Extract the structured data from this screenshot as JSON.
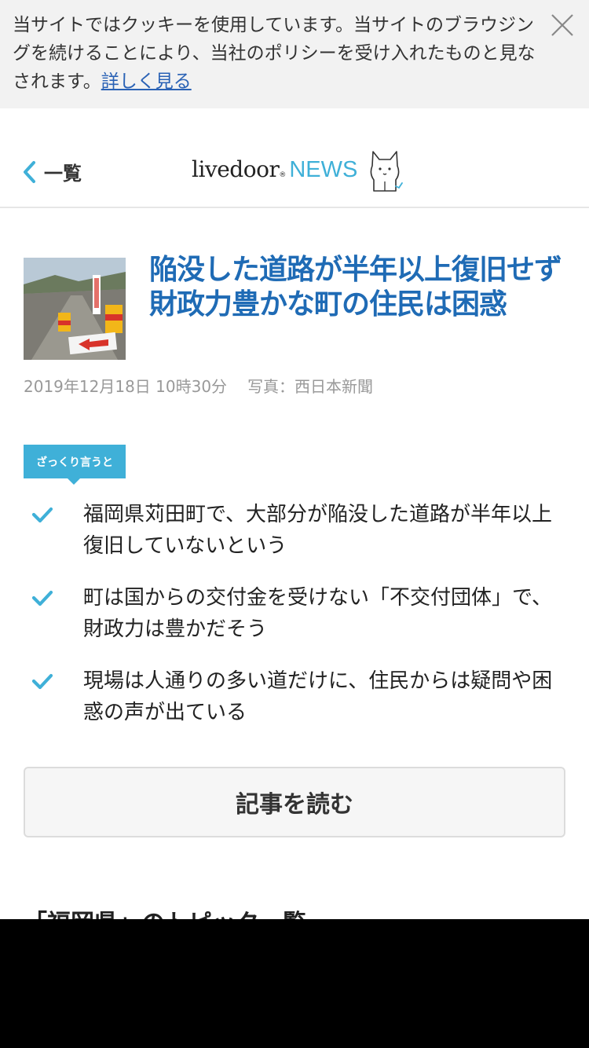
{
  "cookie": {
    "message": "当サイトではクッキーを使用しています。当サイトのブラウジングを続けることにより、当社のポリシーを受け入れたものと見なされます。",
    "link": "詳しく見る"
  },
  "header": {
    "back_label": "一覧",
    "logo_main": "livedoor",
    "logo_mark": "®",
    "logo_news": "NEWS"
  },
  "article": {
    "headline": "陥没した道路が半年以上復旧せず 財政力豊かな町の住民は困惑",
    "date": "2019年12月18日 10時30分",
    "photo_credit": "写真：西日本新聞",
    "tag": "ざっくり言うと",
    "points": [
      "福岡県苅田町で、大部分が陥没した道路が半年以上復旧していないという",
      "町は国からの交付金を受けない「不交付団体」で、財政力は豊かだそう",
      "現場は人通りの多い道だけに、住民からは疑問や困惑の声が出ている"
    ],
    "read_button": "記事を読む"
  },
  "next_section_peek": "「福岡県」のトピック一覧",
  "colors": {
    "accent": "#3fb0d8",
    "headline": "#1f6bb5",
    "link": "#2a62b5"
  },
  "icons": {
    "close": "close-icon",
    "back": "chevron-left-icon",
    "mascot": "livedoor-mascot-icon",
    "check": "check-icon"
  }
}
